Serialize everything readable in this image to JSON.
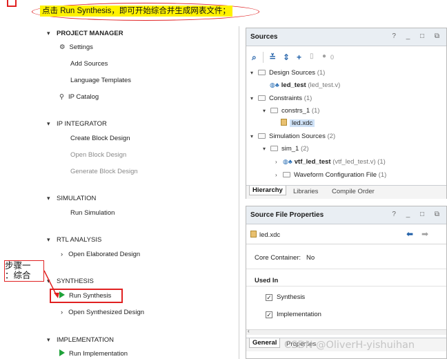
{
  "annotation": {
    "top_note": "点击 Run Synthesis，即可开始综合并生成网表文件；",
    "step_line1": "步骤一",
    "step_line2": "：综合"
  },
  "flow_navigator": {
    "project_manager": {
      "title": "PROJECT MANAGER",
      "settings": "Settings",
      "add_sources": "Add Sources",
      "language_templates": "Language Templates",
      "ip_catalog": "IP Catalog"
    },
    "ip_integrator": {
      "title": "IP INTEGRATOR",
      "create_block_design": "Create Block Design",
      "open_block_design": "Open Block Design",
      "generate_block_design": "Generate Block Design"
    },
    "simulation": {
      "title": "SIMULATION",
      "run_simulation": "Run Simulation"
    },
    "rtl_analysis": {
      "title": "RTL ANALYSIS",
      "open_elaborated_design": "Open Elaborated Design"
    },
    "synthesis": {
      "title": "SYNTHESIS",
      "run_synthesis": "Run Synthesis",
      "open_synthesized_design": "Open Synthesized Design"
    },
    "implementation": {
      "title": "IMPLEMENTATION",
      "run_implementation": "Run Implementation"
    }
  },
  "sources_panel": {
    "title": "Sources",
    "header_tools": "? _ □ ⧉",
    "count_badge": "0",
    "tree": {
      "design_sources": "Design Sources",
      "design_sources_count": "(1)",
      "led_test": "led_test",
      "led_test_file": "(led_test.v)",
      "constraints": "Constraints",
      "constraints_count": "(1)",
      "constrs_1": "constrs_1",
      "constrs_1_count": "(1)",
      "led_xdc": "led.xdc",
      "simulation_sources": "Simulation Sources",
      "simulation_sources_count": "(2)",
      "sim_1": "sim_1",
      "sim_1_count": "(2)",
      "vtf_led_test": "vtf_led_test",
      "vtf_led_test_file": "(vtf_led_test.v) (1)",
      "waveform_config": "Waveform Configuration File",
      "waveform_config_count": "(1)"
    },
    "tabs": [
      "Hierarchy",
      "Libraries",
      "Compile Order"
    ]
  },
  "properties_panel": {
    "title": "Source File Properties",
    "header_tools": "? _ □ ⧉",
    "file_name": "led.xdc",
    "core_container_label": "Core Container:",
    "core_container_value": "No",
    "used_in_label": "Used In",
    "synthesis_label": "Synthesis",
    "implementation_label": "Implementation",
    "tabs": [
      "General",
      "Properties"
    ]
  },
  "watermark": "CSDN @OliverH-yishuihan",
  "colors": {
    "annotation_red": "#e02020",
    "note_highlight": "#fff200",
    "run_green": "#1fa23a",
    "selection_blue": "#cfe2f7"
  }
}
